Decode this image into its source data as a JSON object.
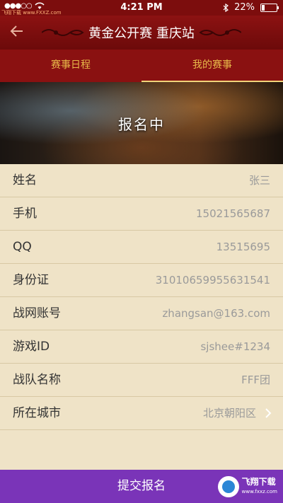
{
  "status_bar": {
    "carrier_dots": "●●●○○",
    "watermark": "飞翔下载 www.FXXZ.com",
    "time": "4:21 PM",
    "battery": "22%",
    "battery_fraction": 0.22
  },
  "header": {
    "title": "黄金公开赛 重庆站"
  },
  "tabs": [
    {
      "label": "赛事日程",
      "active": false
    },
    {
      "label": "我的赛事",
      "active": true
    }
  ],
  "banner": {
    "status_text": "报名中"
  },
  "form": {
    "rows": [
      {
        "label": "姓名",
        "value": "张三"
      },
      {
        "label": "手机",
        "value": "15021565687"
      },
      {
        "label": "QQ",
        "value": "13515695"
      },
      {
        "label": "身份证",
        "value": "31010659955631541"
      },
      {
        "label": "战网账号",
        "value": "zhangsan@163.com"
      },
      {
        "label": "游戏ID",
        "value": "sjshee#1234"
      },
      {
        "label": "战队名称",
        "value": "FFF团"
      },
      {
        "label": "所在城市",
        "value": "北京朝阳区"
      }
    ]
  },
  "submit_label": "提交报名",
  "watermark_logo": {
    "text": "飞翔下载",
    "sub": "www.fxxz.com"
  },
  "colors": {
    "header": "#8a1111",
    "tab_text": "#e8b94a",
    "submit": "#7a34b8",
    "background": "#efe3c7"
  }
}
